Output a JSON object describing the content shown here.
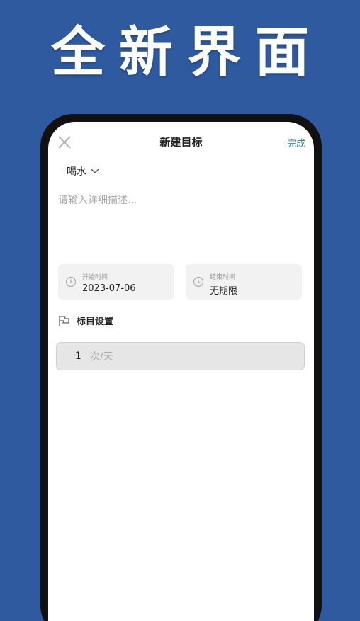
{
  "headline": "全新界面",
  "nav": {
    "title": "新建目标",
    "done_label": "完成"
  },
  "category": {
    "value": "喝水"
  },
  "description": {
    "placeholder": "请输入详细描述..."
  },
  "dates": {
    "start": {
      "label": "开始时间",
      "value": "2023-07-06"
    },
    "end": {
      "label": "结束时间",
      "value": "无期限"
    }
  },
  "goal_settings": {
    "label": "标目设置",
    "frequency_value": "1",
    "frequency_unit": "次/天"
  },
  "colors": {
    "background": "#2f5aa0",
    "accent": "#3b84c8"
  }
}
